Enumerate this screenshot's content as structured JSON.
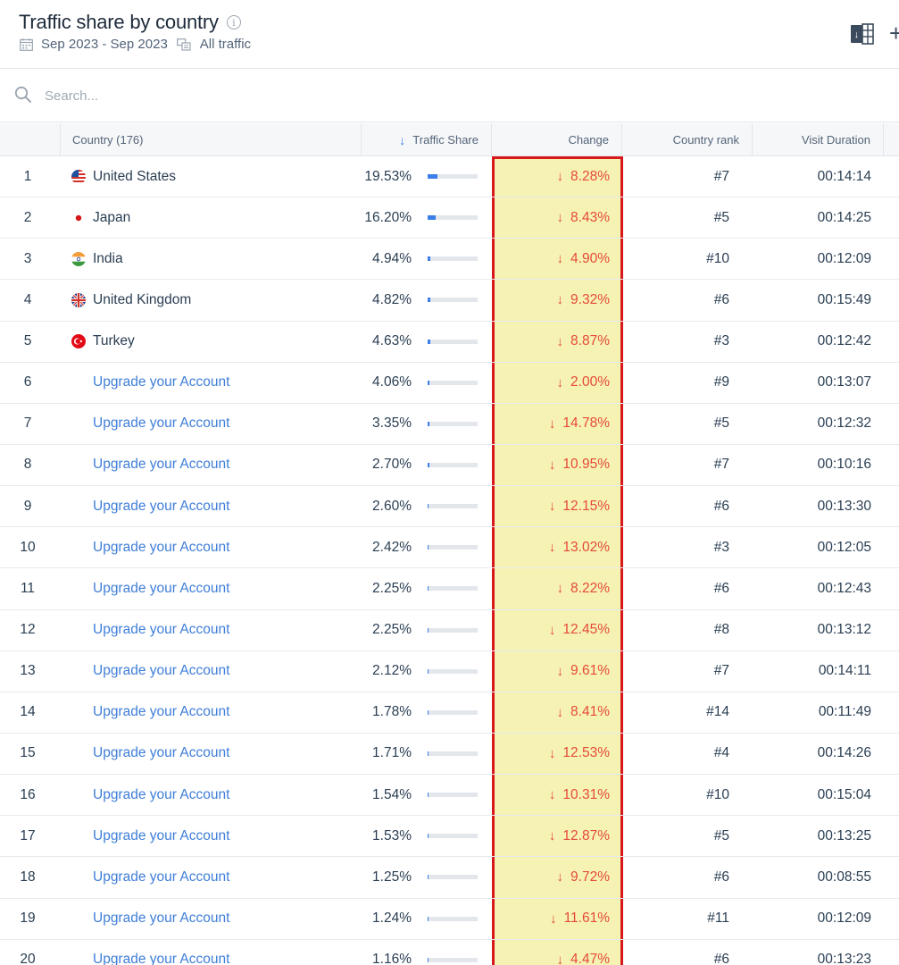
{
  "header": {
    "title": "Traffic share by country",
    "date_range": "Sep 2023 - Sep 2023",
    "traffic_type": "All traffic"
  },
  "search": {
    "placeholder": "Search..."
  },
  "table": {
    "columns": {
      "country": "Country (176)",
      "traffic_share": "Traffic Share",
      "change": "Change",
      "country_rank": "Country rank",
      "visit_duration": "Visit Duration"
    },
    "sort_column": "Traffic Share",
    "rows": [
      {
        "index": "1",
        "country": "United States",
        "flag": "us",
        "share": "19.53%",
        "share_value": 19.53,
        "change": "8.28%",
        "rank": "#7",
        "duration": "00:14:14"
      },
      {
        "index": "2",
        "country": "Japan",
        "flag": "jp",
        "share": "16.20%",
        "share_value": 16.2,
        "change": "8.43%",
        "rank": "#5",
        "duration": "00:14:25"
      },
      {
        "index": "3",
        "country": "India",
        "flag": "in",
        "share": "4.94%",
        "share_value": 4.94,
        "change": "4.90%",
        "rank": "#10",
        "duration": "00:12:09"
      },
      {
        "index": "4",
        "country": "United Kingdom",
        "flag": "gb",
        "share": "4.82%",
        "share_value": 4.82,
        "change": "9.32%",
        "rank": "#6",
        "duration": "00:15:49"
      },
      {
        "index": "5",
        "country": "Turkey",
        "flag": "tr",
        "share": "4.63%",
        "share_value": 4.63,
        "change": "8.87%",
        "rank": "#3",
        "duration": "00:12:42"
      },
      {
        "index": "6",
        "country": "Upgrade your Account",
        "flag": "",
        "share": "4.06%",
        "share_value": 4.06,
        "change": "2.00%",
        "rank": "#9",
        "duration": "00:13:07"
      },
      {
        "index": "7",
        "country": "Upgrade your Account",
        "flag": "",
        "share": "3.35%",
        "share_value": 3.35,
        "change": "14.78%",
        "rank": "#5",
        "duration": "00:12:32"
      },
      {
        "index": "8",
        "country": "Upgrade your Account",
        "flag": "",
        "share": "2.70%",
        "share_value": 2.7,
        "change": "10.95%",
        "rank": "#7",
        "duration": "00:10:16"
      },
      {
        "index": "9",
        "country": "Upgrade your Account",
        "flag": "",
        "share": "2.60%",
        "share_value": 2.6,
        "change": "12.15%",
        "rank": "#6",
        "duration": "00:13:30"
      },
      {
        "index": "10",
        "country": "Upgrade your Account",
        "flag": "",
        "share": "2.42%",
        "share_value": 2.42,
        "change": "13.02%",
        "rank": "#3",
        "duration": "00:12:05"
      },
      {
        "index": "11",
        "country": "Upgrade your Account",
        "flag": "",
        "share": "2.25%",
        "share_value": 2.25,
        "change": "8.22%",
        "rank": "#6",
        "duration": "00:12:43"
      },
      {
        "index": "12",
        "country": "Upgrade your Account",
        "flag": "",
        "share": "2.25%",
        "share_value": 2.25,
        "change": "12.45%",
        "rank": "#8",
        "duration": "00:13:12"
      },
      {
        "index": "13",
        "country": "Upgrade your Account",
        "flag": "",
        "share": "2.12%",
        "share_value": 2.12,
        "change": "9.61%",
        "rank": "#7",
        "duration": "00:14:11"
      },
      {
        "index": "14",
        "country": "Upgrade your Account",
        "flag": "",
        "share": "1.78%",
        "share_value": 1.78,
        "change": "8.41%",
        "rank": "#14",
        "duration": "00:11:49"
      },
      {
        "index": "15",
        "country": "Upgrade your Account",
        "flag": "",
        "share": "1.71%",
        "share_value": 1.71,
        "change": "12.53%",
        "rank": "#4",
        "duration": "00:14:26"
      },
      {
        "index": "16",
        "country": "Upgrade your Account",
        "flag": "",
        "share": "1.54%",
        "share_value": 1.54,
        "change": "10.31%",
        "rank": "#10",
        "duration": "00:15:04"
      },
      {
        "index": "17",
        "country": "Upgrade your Account",
        "flag": "",
        "share": "1.53%",
        "share_value": 1.53,
        "change": "12.87%",
        "rank": "#5",
        "duration": "00:13:25"
      },
      {
        "index": "18",
        "country": "Upgrade your Account",
        "flag": "",
        "share": "1.25%",
        "share_value": 1.25,
        "change": "9.72%",
        "rank": "#6",
        "duration": "00:08:55"
      },
      {
        "index": "19",
        "country": "Upgrade your Account",
        "flag": "",
        "share": "1.24%",
        "share_value": 1.24,
        "change": "11.61%",
        "rank": "#11",
        "duration": "00:12:09"
      },
      {
        "index": "20",
        "country": "Upgrade your Account",
        "flag": "",
        "share": "1.16%",
        "share_value": 1.16,
        "change": "4.47%",
        "rank": "#6",
        "duration": "00:13:23"
      }
    ]
  },
  "colors": {
    "accent": "#3b7ee8",
    "negative": "#e64a3c",
    "highlight_fill": "#f5f2b3",
    "highlight_border": "#d7191c",
    "link": "#3f7ed8"
  },
  "icons": {
    "calendar": "calendar-icon",
    "traffic": "traffic-source-icon",
    "excel": "excel-export-icon",
    "search": "search-icon",
    "info": "info-icon",
    "sort": "arrow-down-icon",
    "change": "arrow-down-icon"
  }
}
